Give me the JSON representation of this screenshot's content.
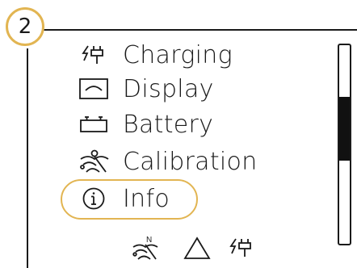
{
  "step": {
    "number": "2"
  },
  "menu": {
    "items": [
      {
        "label": "Charging",
        "icon": "charging-plug-icon"
      },
      {
        "label": "Display",
        "icon": "display-icon"
      },
      {
        "label": "Battery",
        "icon": "battery-icon"
      },
      {
        "label": "Calibration",
        "icon": "calibration-icon"
      },
      {
        "label": "Info",
        "icon": "info-icon"
      }
    ],
    "selected_index": 4
  },
  "scrollbar": {
    "thumb_start": 0.26,
    "thumb_end": 0.58
  },
  "status_bar": {
    "icons": [
      "calibration-north-icon",
      "warning-triangle-icon",
      "charging-plug-icon"
    ],
    "calibration_letter": "N"
  },
  "colors": {
    "accent": "#e2b552",
    "foreground": "#1a1a1a"
  }
}
